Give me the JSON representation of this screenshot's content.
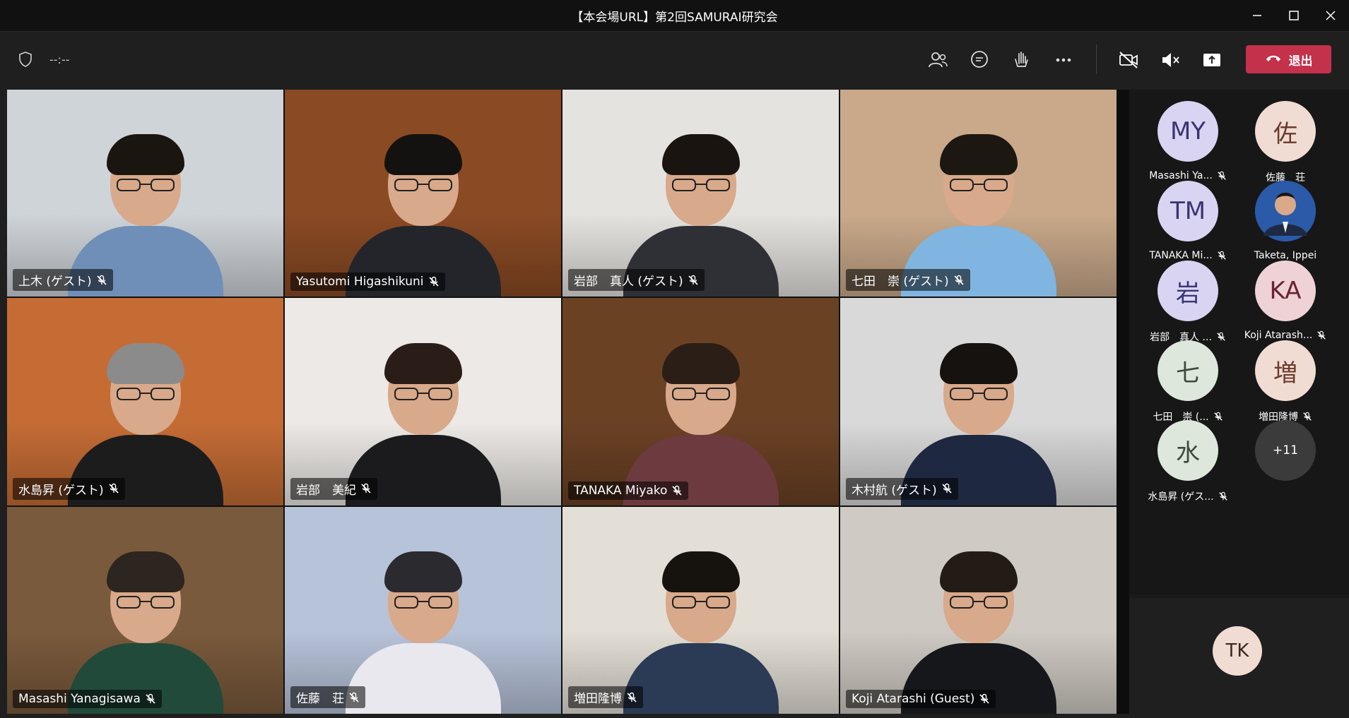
{
  "window": {
    "title": "【本会場URL】第2回SAMURAI研究会",
    "controls": [
      "minimize-icon",
      "maximize-icon",
      "close-icon"
    ]
  },
  "toolbar": {
    "timer": "--:--",
    "icons": [
      "people-icon",
      "chat-icon",
      "raise-hand-icon",
      "more-icon",
      "camera-off-icon",
      "speaker-mute-icon",
      "share-screen-icon"
    ],
    "leave_label": "退出",
    "leave_color": "#c4314b"
  },
  "videos": [
    {
      "name": "上木 (ゲスト)",
      "bg": "#cfd4d9",
      "shirt": "#6f8fb8",
      "hair": "#1b1510"
    },
    {
      "name": "Yasutomi Higashikuni",
      "bg": "#8a4a24",
      "shirt": "#23252b",
      "hair": "#141210"
    },
    {
      "name": "岩部　真人 (ゲスト)",
      "bg": "#e5e3df",
      "shirt": "#2f3035",
      "hair": "#1a1410"
    },
    {
      "name": "七田　崇 (ゲスト)",
      "bg": "#c9a98a",
      "shirt": "#7fb5e0",
      "hair": "#1d1712"
    },
    {
      "name": "水島昇 (ゲスト)",
      "bg": "#c56c35",
      "shirt": "#1c1c1c",
      "hair": "#8b8b8b"
    },
    {
      "name": "岩部　美紀",
      "bg": "#ece9e6",
      "shirt": "#1b1b1d",
      "hair": "#2a1d17"
    },
    {
      "name": "TANAKA Miyako",
      "bg": "#6b4124",
      "shirt": "#6d3a3f",
      "hair": "#2a1e16"
    },
    {
      "name": "木村航 (ゲスト)",
      "bg": "#d9d9d9",
      "shirt": "#1e2840",
      "hair": "#15120f"
    },
    {
      "name": "Masashi Yanagisawa",
      "bg": "#7a5a3c",
      "shirt": "#214a3a",
      "hair": "#2c2520"
    },
    {
      "name": "佐藤　荘",
      "bg": "#b7c3d9",
      "shirt": "#e8e8ee",
      "hair": "#2a2a2f"
    },
    {
      "name": "増田隆博",
      "bg": "#e3dfd6",
      "shirt": "#2b3b55",
      "hair": "#16130f"
    },
    {
      "name": "Koji Atarashi (Guest)",
      "bg": "#cfcac3",
      "shirt": "#15171b",
      "hair": "#231c16"
    }
  ],
  "roster": [
    {
      "initials": "MY",
      "label": "Masashi Ya...",
      "bg": "#d8d4f2",
      "fg": "#3a3470",
      "muted": true
    },
    {
      "initials": "佐",
      "label": "佐藤　荘",
      "bg": "#f1dcd3",
      "fg": "#6a3b2c",
      "muted": false
    },
    {
      "initials": "TM",
      "label": "TANAKA Mi...",
      "bg": "#d8d4f2",
      "fg": "#3a3470",
      "muted": true
    },
    {
      "initials": "",
      "label": "Taketa, Ippei",
      "bg": "#2a5aa8",
      "fg": "#ffffff",
      "muted": false,
      "photo": true
    },
    {
      "initials": "岩",
      "label": "岩部　真人 ...",
      "bg": "#d8d4f2",
      "fg": "#3a3470",
      "muted": true
    },
    {
      "initials": "KA",
      "label": "Koji Atarash...",
      "bg": "#efd2d6",
      "fg": "#6a2430",
      "muted": true
    },
    {
      "initials": "七",
      "label": "七田　崇 (...",
      "bg": "#dde7dc",
      "fg": "#3a4a38",
      "muted": true
    },
    {
      "initials": "増",
      "label": "増田隆博",
      "bg": "#f1dcd3",
      "fg": "#6a3b2c",
      "muted": true
    },
    {
      "initials": "水",
      "label": "水島昇 (ゲス...",
      "bg": "#dde7dc",
      "fg": "#3a4a38",
      "muted": true
    },
    {
      "initials": "+11",
      "label": "",
      "bg": "#3b3b3b",
      "fg": "#ffffff",
      "muted": false,
      "overflow": true
    }
  ],
  "self": {
    "initials": "TK"
  }
}
